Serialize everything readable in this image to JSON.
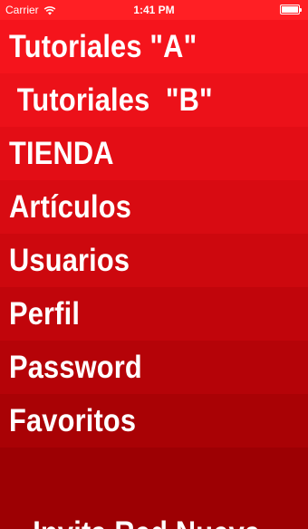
{
  "status_bar": {
    "carrier": "Carrier",
    "time": "1:41 PM",
    "icons": [
      "wifi-icon",
      "battery-icon"
    ]
  },
  "menu": {
    "items": [
      {
        "label": "Tutoriales \"A\"",
        "color": "#f5141c"
      },
      {
        "label": " Tutoriales  \"B\"",
        "color": "#ec1119"
      },
      {
        "label": "TIENDA",
        "color": "#e30d15"
      },
      {
        "label": "Artículos",
        "color": "#d80b12"
      },
      {
        "label": "Usuarios",
        "color": "#cd080e"
      },
      {
        "label": "Perfil",
        "color": "#c1050b"
      },
      {
        "label": "Password",
        "color": "#b50308"
      },
      {
        "label": "Favoritos",
        "color": "#a90205"
      },
      {
        "label": "...Invita Red Nueva",
        "color": "#9d0003"
      }
    ]
  }
}
